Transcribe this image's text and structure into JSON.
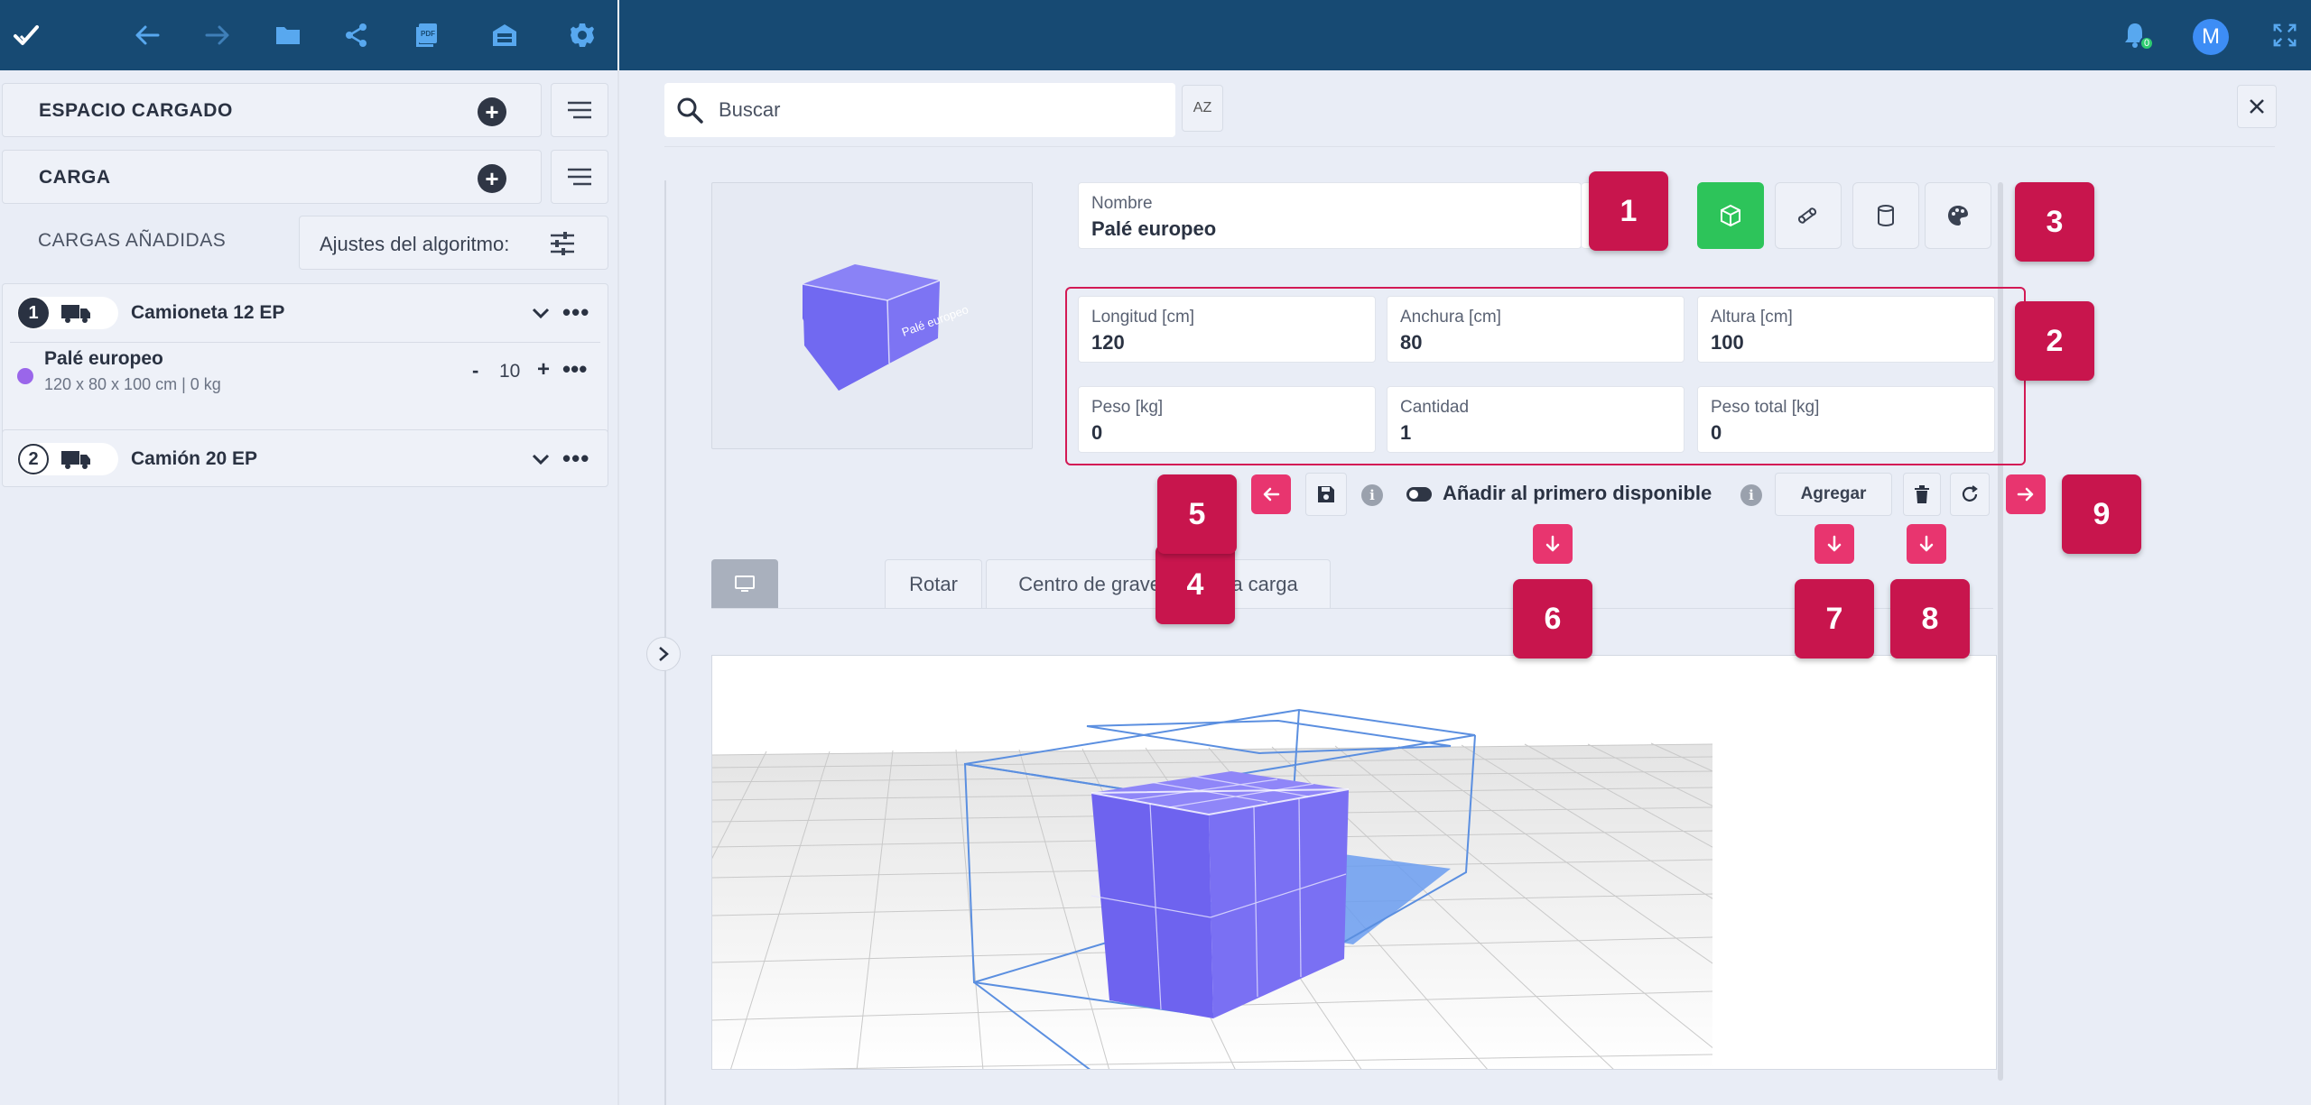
{
  "topbar": {
    "left_icons": [
      "check-icon",
      "back-arrow-icon",
      "forward-arrow-icon",
      "folder-icon",
      "share-icon",
      "pdf-icon",
      "warehouse-icon",
      "gear-icon"
    ],
    "notifications_count": "0",
    "avatar_initial": "M"
  },
  "sidebar": {
    "espacio_label": "ESPACIO CARGADO",
    "carga_label": "CARGA",
    "cargas_added_label": "CARGAS AÑADIDAS",
    "algo_label": "Ajustes del algoritmo:",
    "vehicles": [
      {
        "number": "1",
        "name": "Camioneta 12 EP",
        "cargo": {
          "name": "Palé europeo",
          "dims": "120 x 80 x 100 cm | 0 kg",
          "qty_minus": "-",
          "qty": "10",
          "qty_plus": "+",
          "color": "#9a66ea"
        }
      },
      {
        "number": "2",
        "name": "Camión 20 EP"
      }
    ]
  },
  "main": {
    "search_placeholder": "Buscar",
    "az_label": "AZ",
    "preview_label": "Palé europeo",
    "form": {
      "nombre_label": "Nombre",
      "nombre_value": "Palé europeo",
      "longitud_label": "Longitud [cm]",
      "longitud_value": "120",
      "anchura_label": "Anchura [cm]",
      "anchura_value": "80",
      "altura_label": "Altura [cm]",
      "altura_value": "100",
      "peso_label": "Peso [kg]",
      "peso_value": "0",
      "cantidad_label": "Cantidad",
      "cantidad_value": "1",
      "peso_total_label": "Peso total [kg]",
      "peso_total_value": "0"
    },
    "shape_buttons": [
      "box-shape-icon",
      "roll-shape-icon",
      "cylinder-shape-icon",
      "palette-icon"
    ],
    "first_available_label": "Añadir al primero disponible",
    "agregar_label": "Agregar",
    "tabs": {
      "rotar": "Rotar",
      "centro": "Centro de gravedad de la carga"
    },
    "badges": [
      "1",
      "2",
      "3",
      "4",
      "5",
      "6",
      "7",
      "8",
      "9"
    ]
  },
  "colors": {
    "topbar": "#174a73",
    "accent_pink": "#e8356f",
    "badge": "#c8154d",
    "box_green": "#2dc45a",
    "cargo_purple": "#7b6ff2"
  }
}
